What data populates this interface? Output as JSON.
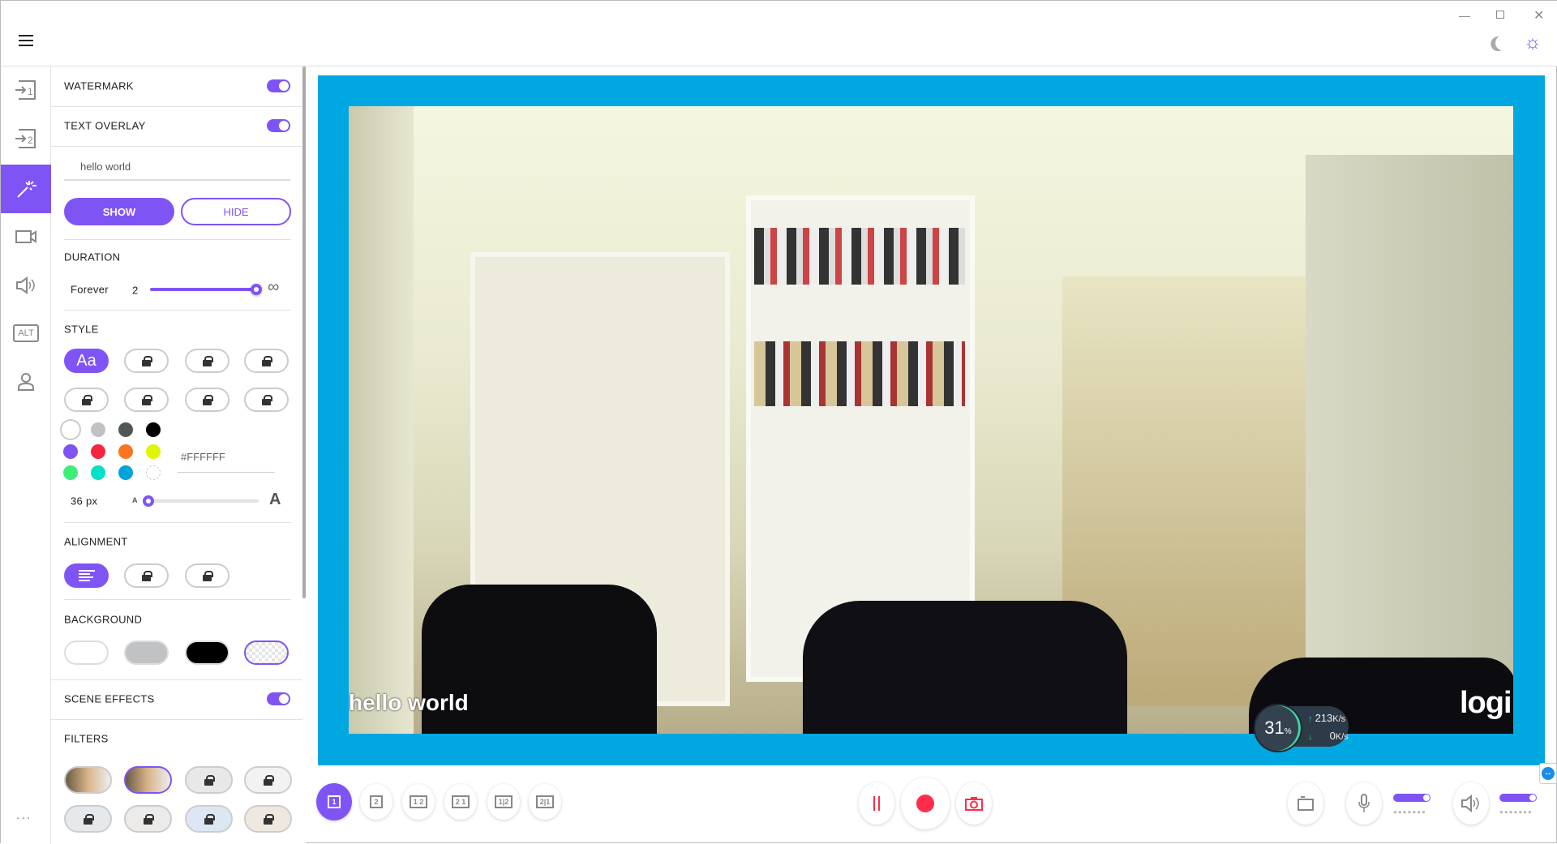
{
  "colors": {
    "accent": "#7f54f5",
    "frame": "#00a7e1",
    "record": "#ff2d4b"
  },
  "window": {
    "minimize_icon": "minimize-icon",
    "restore_icon": "restore-icon",
    "close_icon": "close-icon",
    "dark_mode_icon": "moon-icon",
    "light_mode_icon": "sun-icon"
  },
  "rail": {
    "items": [
      {
        "name": "source-1",
        "icon": "input-1-icon"
      },
      {
        "name": "source-2",
        "icon": "input-2-icon"
      },
      {
        "name": "effects",
        "icon": "magic-wand-icon",
        "active": true
      },
      {
        "name": "camera",
        "icon": "camera-icon"
      },
      {
        "name": "audio",
        "icon": "speaker-icon"
      },
      {
        "name": "alt",
        "icon": "alt-icon",
        "label": "ALT"
      },
      {
        "name": "account",
        "icon": "user-icon"
      }
    ],
    "more": "..."
  },
  "panel": {
    "watermark": {
      "label": "WATERMARK",
      "enabled": true
    },
    "text_overlay": {
      "label": "TEXT OVERLAY",
      "enabled": true,
      "value": "hello world",
      "show": "SHOW",
      "hide": "HIDE"
    },
    "duration": {
      "label": "DURATION",
      "mode": "Forever",
      "value": "2",
      "infinity": "∞",
      "slider_fraction": 1.0
    },
    "style": {
      "label": "STYLE",
      "selected": "Aa",
      "options_locked": 7
    },
    "color": {
      "hex": "#FFFFFF",
      "swatches": [
        "#ffffff",
        "#c0c2c4",
        "#505558",
        "#000000",
        "#7f54f5",
        "#f5263f",
        "#fc7420",
        "#e0f500",
        "#3ded7a",
        "#00e1c8",
        "#00a3dc",
        "transparent"
      ]
    },
    "size": {
      "value": "36 px",
      "small": "A",
      "large": "A",
      "fraction": 0.0
    },
    "alignment": {
      "label": "ALIGNMENT",
      "selected": "left"
    },
    "background": {
      "label": "BACKGROUND",
      "options": [
        "white",
        "gray",
        "black",
        "transparent"
      ],
      "selected": "transparent"
    },
    "scene_effects": {
      "label": "SCENE EFFECTS",
      "enabled": true
    },
    "filters": {
      "label": "FILTERS",
      "selected": 1
    }
  },
  "preview": {
    "overlay_text": "hello world",
    "logo": "logi",
    "stats": {
      "cpu": "31",
      "cpu_unit": "%",
      "up": "213",
      "down": "0",
      "unit": "K/s"
    }
  },
  "toolbar": {
    "layouts": [
      "1",
      "2",
      "1 2",
      "2 1",
      "1|2",
      "2|1"
    ],
    "selected_layout": 0,
    "mic_level": 1.0,
    "speaker_level": 1.0
  }
}
